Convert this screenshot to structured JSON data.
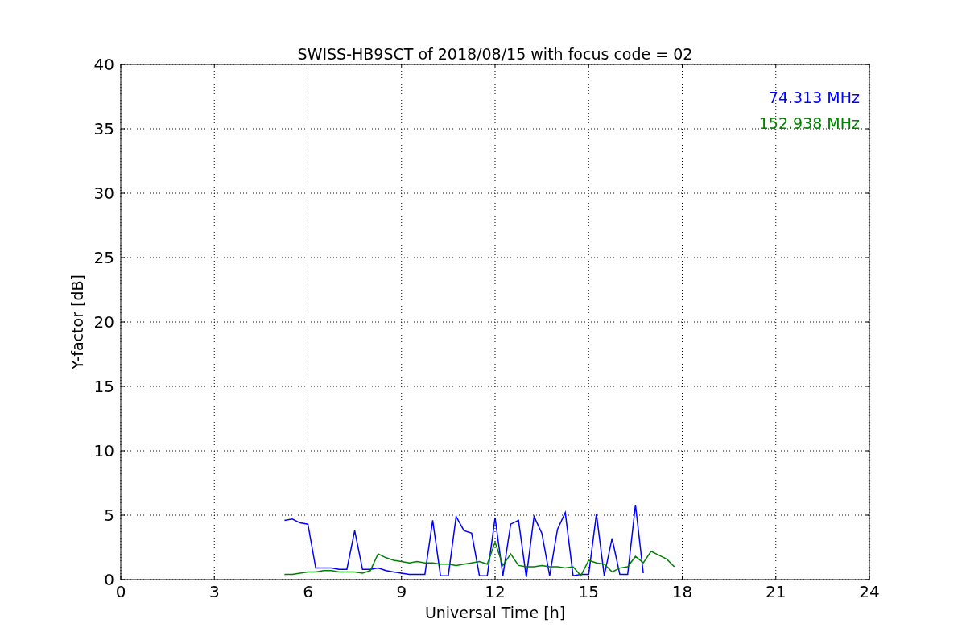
{
  "chart_data": {
    "type": "line",
    "title": "SWISS-HB9SCT of 2018/08/15 with focus code = 02",
    "xlabel": "Universal Time [h]",
    "ylabel": "Y-factor [dB]",
    "x": [
      5.25,
      5.5,
      5.75,
      6.0,
      6.25,
      6.5,
      6.75,
      7.0,
      7.25,
      7.5,
      7.75,
      8.0,
      8.25,
      8.5,
      8.75,
      9.0,
      9.25,
      9.5,
      9.75,
      10.0,
      10.25,
      10.5,
      10.75,
      11.0,
      11.25,
      11.5,
      11.75,
      12.0,
      12.25,
      12.5,
      12.75,
      13.0,
      13.25,
      13.5,
      13.75,
      14.0,
      14.25,
      14.5,
      14.75,
      15.0,
      15.25,
      15.5,
      15.75,
      16.0,
      16.25,
      16.5,
      16.75,
      17.0,
      17.25,
      17.5,
      17.75
    ],
    "series": [
      {
        "name": "74.313 MHz",
        "color": "#0000ff",
        "values": [
          4.6,
          4.7,
          4.4,
          4.3,
          0.9,
          0.9,
          0.9,
          0.8,
          0.8,
          3.8,
          0.8,
          0.8,
          0.9,
          0.7,
          0.6,
          0.5,
          0.4,
          0.4,
          0.4,
          4.6,
          0.3,
          0.3,
          4.9,
          3.8,
          3.6,
          0.3,
          0.3,
          4.8,
          0.3,
          4.3,
          4.6,
          0.2,
          4.9,
          3.6,
          0.3,
          3.9,
          5.2,
          0.3,
          0.4,
          0.4,
          5.1,
          0.3,
          3.2,
          0.4,
          0.4,
          5.8,
          0.5,
          null,
          null,
          null,
          null
        ]
      },
      {
        "name": "152.938 MHz",
        "color": "#008000",
        "values": [
          0.4,
          0.4,
          0.5,
          0.6,
          0.6,
          0.7,
          0.7,
          0.6,
          0.6,
          0.6,
          0.5,
          0.7,
          2.0,
          1.7,
          1.5,
          1.4,
          1.3,
          1.4,
          1.3,
          1.3,
          1.2,
          1.2,
          1.1,
          1.2,
          1.3,
          1.4,
          1.2,
          2.9,
          1.1,
          2.0,
          1.1,
          1.0,
          1.0,
          1.1,
          1.0,
          1.0,
          0.9,
          1.0,
          0.3,
          1.5,
          1.3,
          1.2,
          0.6,
          0.9,
          1.0,
          1.8,
          1.3,
          2.2,
          1.9,
          1.6,
          1.0
        ]
      }
    ],
    "grid": true,
    "xlim": [
      0,
      24
    ],
    "ylim": [
      0,
      40
    ],
    "xticks": [
      0,
      3,
      6,
      9,
      12,
      15,
      18,
      21,
      24
    ],
    "yticks": [
      0,
      5,
      10,
      15,
      20,
      25,
      30,
      35,
      40
    ]
  }
}
